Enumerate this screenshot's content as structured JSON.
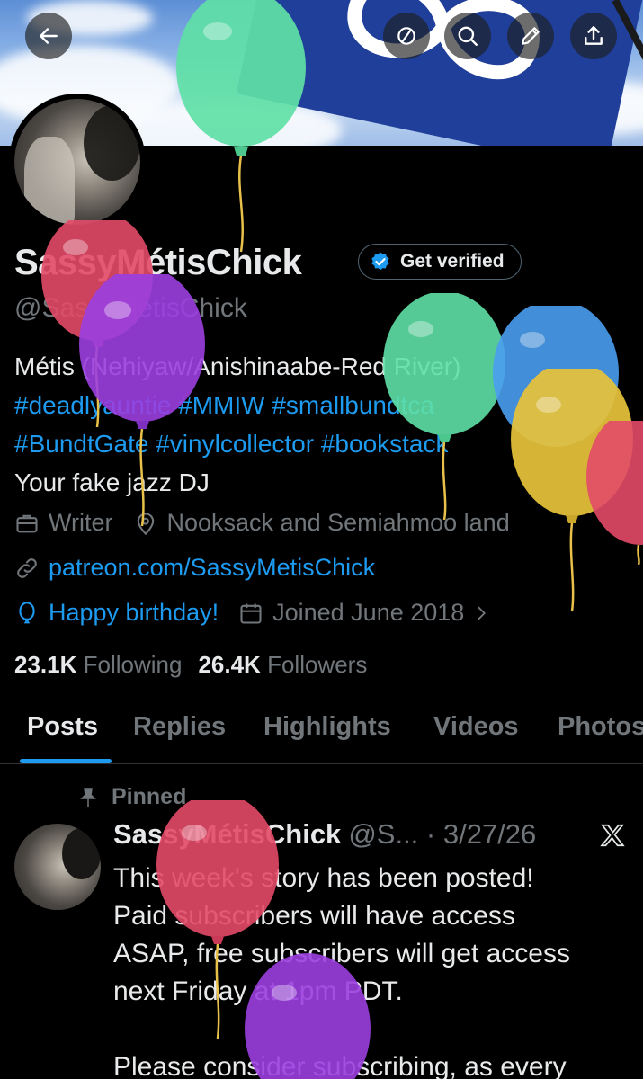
{
  "profile": {
    "name": "SassyMétisChick",
    "handle": "@SassyMetisChick",
    "verify_label": "Get verified",
    "bio_line1": "Métis (Nehiyaw/Anishinaabe-Red River)",
    "bio_line2": "#deadlyauntie #MMIW #smallbundtca",
    "bio_line3": "#BundtGate #vinylcollector #bookstack",
    "bio_line4": "Your fake jazz DJ",
    "profession": "Writer",
    "location": "Nooksack and Semiahmoo land",
    "website": "patreon.com/SassyMetisChick",
    "birthday": "Happy birthday!",
    "joined": "Joined June 2018",
    "following_count": "23.1K",
    "following_label": "Following",
    "followers_count": "26.4K",
    "followers_label": "Followers"
  },
  "tabs": [
    "Posts",
    "Replies",
    "Highlights",
    "Videos",
    "Photos"
  ],
  "post": {
    "pinned_label": "Pinned",
    "author": "SassyMétisChick",
    "handle_date": "@S... · 3/27/26",
    "body": "This week's story has been posted!\nPaid subscribers will have access\nASAP, free subscribers will get access\nnext Friday at 1pm PDT.\n\nPlease consider subscribing, as every"
  },
  "icons": {
    "back": "arrow-left-icon",
    "circle": "no-retweets-icon",
    "search": "search-icon",
    "edit": "pencil-icon",
    "share": "share-icon",
    "verified": "verified-badge-icon",
    "briefcase": "briefcase-icon",
    "location": "location-pin-icon",
    "link": "link-icon",
    "balloon": "balloon-icon",
    "calendar": "calendar-icon",
    "pin": "pin-icon",
    "x": "x-logo-icon"
  },
  "colors": {
    "accent": "#1d9bf0",
    "muted": "#71767b",
    "text": "#e7e9ea"
  }
}
